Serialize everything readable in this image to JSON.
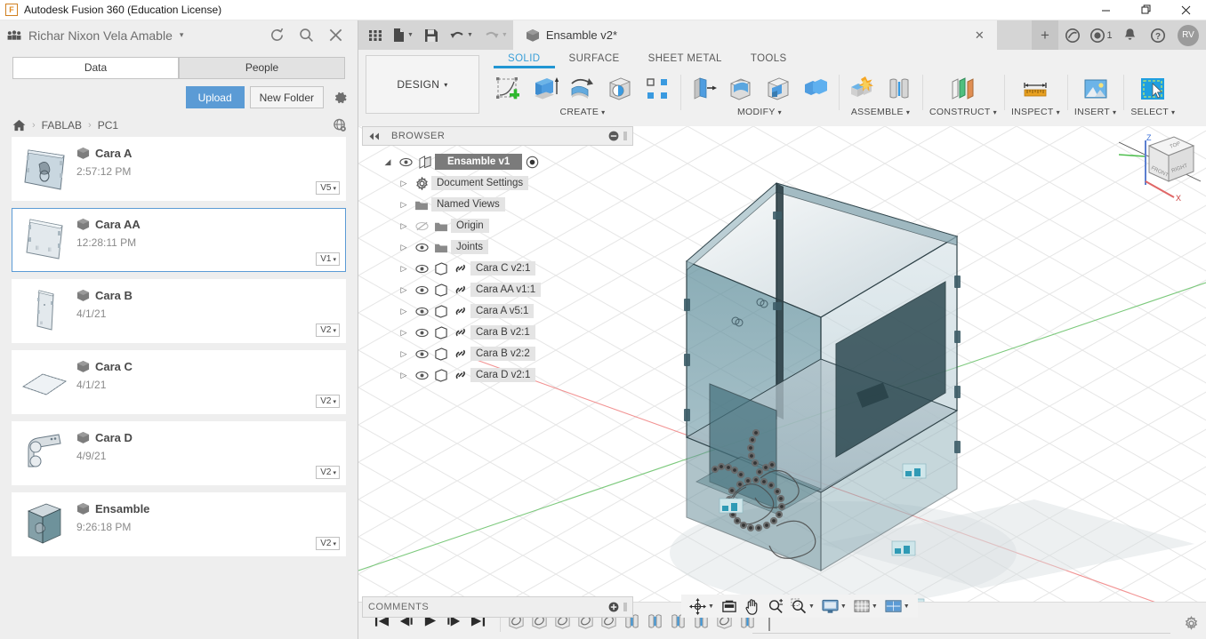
{
  "window": {
    "title": "Autodesk Fusion 360 (Education License)",
    "app_logo_letter": "F",
    "minimize_label": "—",
    "maximize_label": "❐",
    "close_label": "✕"
  },
  "left_panel": {
    "user_name": "Richar Nixon Vela Amable",
    "user_caret": "▾",
    "refresh_icon": "refresh-icon",
    "search_icon": "search-icon",
    "close_icon": "close-icon",
    "tabs": [
      {
        "label": "Data",
        "active": true
      },
      {
        "label": "People",
        "active": false
      }
    ],
    "actions": {
      "upload_label": "Upload",
      "new_folder_label": "New Folder",
      "settings_icon": "gear-icon"
    },
    "breadcrumb": {
      "home_icon": "home-icon",
      "items": [
        "FABLAB",
        "PC1"
      ],
      "separator": "›",
      "globe_icon": "globe-icon"
    },
    "files": [
      {
        "name": "Cara A",
        "date": "2:57:12 PM",
        "version": "V5",
        "selected": false,
        "thumb": "plate-a-thumb"
      },
      {
        "name": "Cara AA",
        "date": "12:28:11 PM",
        "version": "V1",
        "selected": true,
        "thumb": "plate-aa-thumb"
      },
      {
        "name": "Cara B",
        "date": "4/1/21",
        "version": "V2",
        "selected": false,
        "thumb": "plate-b-thumb"
      },
      {
        "name": "Cara C",
        "date": "4/1/21",
        "version": "V2",
        "selected": false,
        "thumb": "plate-c-thumb"
      },
      {
        "name": "Cara D",
        "date": "4/9/21",
        "version": "V2",
        "selected": false,
        "thumb": "bracket-d-thumb"
      },
      {
        "name": "Ensamble",
        "date": "9:26:18 PM",
        "version": "V2",
        "selected": false,
        "thumb": "assembly-thumb"
      }
    ],
    "version_caret": "▾"
  },
  "quick_access": {
    "icons": [
      {
        "name": "app-grid-icon",
        "caret": false,
        "dim": false
      },
      {
        "name": "new-file-icon",
        "caret": true,
        "dim": false
      },
      {
        "name": "save-icon",
        "caret": false,
        "dim": false
      },
      {
        "name": "undo-icon",
        "caret": true,
        "dim": false
      },
      {
        "name": "redo-icon",
        "caret": true,
        "dim": true
      }
    ],
    "document_tab": {
      "title": "Ensamble v2*",
      "cube_icon": "cube-icon",
      "close_label": "✕"
    },
    "new_tab_label": "+",
    "tray": [
      {
        "name": "extensions-icon",
        "badge": ""
      },
      {
        "name": "job-status-icon",
        "badge": "1"
      },
      {
        "name": "notifications-bell-icon",
        "badge": ""
      },
      {
        "name": "help-icon",
        "badge": ""
      }
    ],
    "avatar_initials": "RV"
  },
  "ribbon": {
    "design_label": "DESIGN",
    "design_caret": "▾",
    "tabs": [
      {
        "label": "SOLID",
        "active": true
      },
      {
        "label": "SURFACE",
        "active": false
      },
      {
        "label": "SHEET METAL",
        "active": false
      },
      {
        "label": "TOOLS",
        "active": false
      }
    ],
    "groups": [
      {
        "label": "CREATE",
        "caret": "▾",
        "icons": [
          "create-sketch-icon",
          "extrude-icon",
          "revolve-icon",
          "hole-icon",
          "pattern-icon"
        ]
      },
      {
        "label": "MODIFY",
        "caret": "▾",
        "icons": [
          "press-pull-icon",
          "fillet-icon",
          "shell-icon",
          "combine-icon"
        ]
      },
      {
        "label": "ASSEMBLE",
        "caret": "▾",
        "icons": [
          "new-component-icon",
          "joint-icon"
        ]
      },
      {
        "label": "CONSTRUCT",
        "caret": "▾",
        "icons": [
          "offset-plane-icon"
        ]
      },
      {
        "label": "INSPECT",
        "caret": "▾",
        "icons": [
          "measure-icon"
        ]
      },
      {
        "label": "INSERT",
        "caret": "▾",
        "icons": [
          "insert-image-icon"
        ]
      },
      {
        "label": "SELECT",
        "caret": "▾",
        "icons": [
          "select-window-icon"
        ]
      }
    ]
  },
  "browser": {
    "title": "BROWSER",
    "collapse_icon": "collapse-left-icon",
    "minimize_icon": "minimize-panel-icon",
    "grip_icon": "grip-icon",
    "tree": [
      {
        "label": "Ensamble v1",
        "depth": 0,
        "root": true,
        "arrow": "◢",
        "eye": "visible",
        "icon": "assembly-icon",
        "radio": true
      },
      {
        "label": "Document Settings",
        "depth": 1,
        "root": false,
        "arrow": "▷",
        "eye": "none",
        "icon": "gear-icon",
        "radio": false
      },
      {
        "label": "Named Views",
        "depth": 1,
        "root": false,
        "arrow": "▷",
        "eye": "none",
        "icon": "folder-icon",
        "radio": false
      },
      {
        "label": "Origin",
        "depth": 2,
        "root": false,
        "arrow": "▷",
        "eye": "hidden",
        "icon": "folder-icon",
        "radio": false
      },
      {
        "label": "Joints",
        "depth": 2,
        "root": false,
        "arrow": "▷",
        "eye": "visible",
        "icon": "folder-icon",
        "radio": false
      },
      {
        "label": "Cara C v2:1",
        "depth": 2,
        "root": false,
        "arrow": "▷",
        "eye": "visible",
        "icon": "component-link-icon",
        "radio": false
      },
      {
        "label": "Cara AA v1:1",
        "depth": 2,
        "root": false,
        "arrow": "▷",
        "eye": "visible",
        "icon": "component-link-icon",
        "radio": false
      },
      {
        "label": "Cara A v5:1",
        "depth": 2,
        "root": false,
        "arrow": "▷",
        "eye": "visible",
        "icon": "component-link-icon",
        "radio": false
      },
      {
        "label": "Cara B v2:1",
        "depth": 2,
        "root": false,
        "arrow": "▷",
        "eye": "visible",
        "icon": "component-link-icon",
        "radio": false
      },
      {
        "label": "Cara B v2:2",
        "depth": 2,
        "root": false,
        "arrow": "▷",
        "eye": "visible",
        "icon": "component-link-icon",
        "radio": false
      },
      {
        "label": "Cara D v2:1",
        "depth": 2,
        "root": false,
        "arrow": "▷",
        "eye": "visible",
        "icon": "component-link-icon",
        "radio": false
      }
    ]
  },
  "comments": {
    "title": "COMMENTS",
    "add_icon": "add-comment-icon",
    "grip_icon": "grip-icon"
  },
  "navbar": {
    "items": [
      {
        "name": "orbit-icon",
        "caret": true
      },
      {
        "name": "look-at-icon",
        "caret": false
      },
      {
        "name": "pan-icon",
        "caret": false
      },
      {
        "name": "zoom-icon",
        "caret": false
      },
      {
        "name": "zoom-window-icon",
        "caret": true
      },
      {
        "name": "display-settings-icon",
        "caret": true
      },
      {
        "name": "grid-snaps-icon",
        "caret": true
      },
      {
        "name": "viewports-icon",
        "caret": true
      }
    ]
  },
  "viewcube": {
    "faces": {
      "top": "TOP",
      "front": "FRONT",
      "right": "RIGHT"
    },
    "axes": {
      "x": "X",
      "z": "Z"
    }
  },
  "timeline": {
    "playback": [
      {
        "name": "go-to-beginning-icon",
        "glyph": "⏮"
      },
      {
        "name": "step-back-icon",
        "glyph": "◀▏"
      },
      {
        "name": "play-icon",
        "glyph": "▶"
      },
      {
        "name": "step-forward-icon",
        "glyph": "▏▶"
      },
      {
        "name": "go-to-end-icon",
        "glyph": "⏭"
      }
    ],
    "features": [
      {
        "name": "timeline-feature-joint",
        "type": "joint"
      },
      {
        "name": "timeline-feature-joint",
        "type": "joint"
      },
      {
        "name": "timeline-feature-joint",
        "type": "joint"
      },
      {
        "name": "timeline-feature-joint",
        "type": "joint"
      },
      {
        "name": "timeline-feature-joint",
        "type": "joint"
      },
      {
        "name": "timeline-feature-asbuilt",
        "type": "asbuilt"
      },
      {
        "name": "timeline-feature-asbuilt",
        "type": "asbuilt"
      },
      {
        "name": "timeline-feature-asbuilt",
        "type": "asbuilt"
      },
      {
        "name": "timeline-feature-asbuilt",
        "type": "asbuilt"
      },
      {
        "name": "timeline-feature-joint",
        "type": "joint"
      },
      {
        "name": "timeline-feature-asbuilt",
        "type": "asbuilt"
      }
    ],
    "settings_icon": "gear-icon"
  }
}
